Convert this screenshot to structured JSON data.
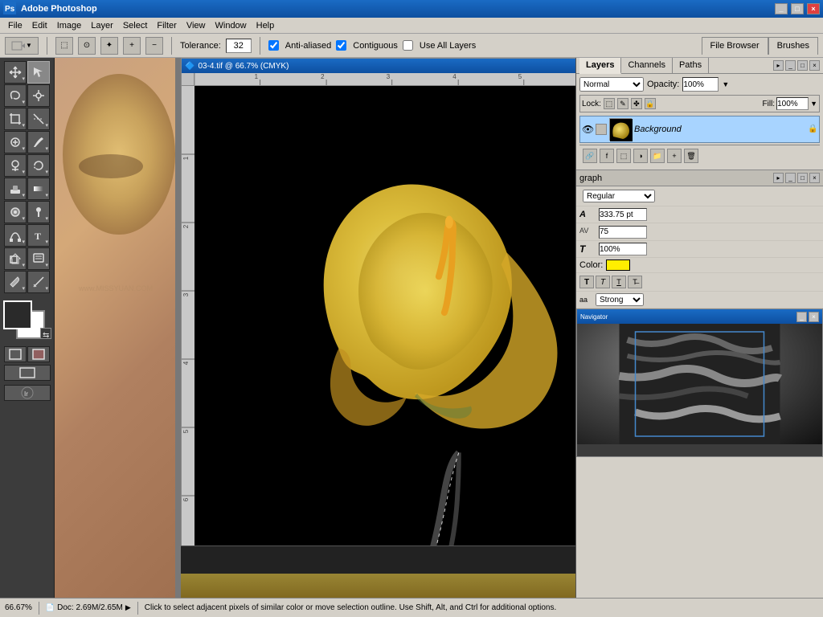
{
  "app": {
    "title": "Adobe Photoshop",
    "win_btns": [
      "_",
      "□",
      "×"
    ]
  },
  "menu": {
    "items": [
      "File",
      "Edit",
      "Image",
      "Layer",
      "Select",
      "Filter",
      "View",
      "Window",
      "Help"
    ]
  },
  "options_bar": {
    "tolerance_label": "Tolerance:",
    "tolerance_value": "32",
    "anti_aliased_label": "Anti-aliased",
    "contiguous_label": "Contiguous",
    "use_all_layers_label": "Use All Layers"
  },
  "top_right": {
    "file_browser": "File Browser",
    "brushes": "Brushes"
  },
  "document": {
    "title": "03-4.tif @ 66.7% (CMYK)",
    "zoom": "66.67%",
    "doc_size": "Doc: 2.69M/2.65M"
  },
  "status_bar": {
    "zoom": "66.67%",
    "doc_info": "Doc: 2.69M/2.65M",
    "hint": "Click to select adjacent pixels of similar color or move selection outline. Use Shift, Alt, and Ctrl for additional options."
  },
  "layers_panel": {
    "tabs": [
      "Layers",
      "Channels",
      "Paths"
    ],
    "blend_mode": "Normal",
    "opacity_label": "Opacity:",
    "opacity_value": "100%",
    "fill_label": "Fill:",
    "fill_value": "100%",
    "lock_label": "Lock:",
    "layer_name": "Background"
  },
  "char_panel": {
    "title": "graph",
    "font_size_label": "A",
    "font_size_value": "333.75 pt",
    "leading_label": "AV",
    "leading_value": "75",
    "scale_label": "T",
    "scale_value": "100%",
    "color_label": "Color:",
    "aa_label": "Strong",
    "style": "Regular"
  },
  "watermark": "www.MISSYUAN.COM"
}
